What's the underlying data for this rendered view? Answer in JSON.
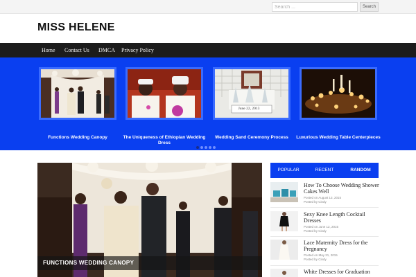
{
  "search": {
    "placeholder": "Search ...",
    "button_label": "Search"
  },
  "site": {
    "title": "MISS HELENE"
  },
  "nav": {
    "items": [
      "Home",
      "Contact Us",
      "DMCA",
      "Privacy Policy"
    ]
  },
  "slider": {
    "slides": [
      {
        "caption": "Functions Wedding Canopy"
      },
      {
        "caption": "The Uniqueness of Ethiopian Wedding Dress"
      },
      {
        "caption": "Wedding Sand Ceremony Process",
        "sign_text": "June 22, 2013"
      },
      {
        "caption": "Luxurious Wedding Table Centerpieces"
      }
    ],
    "dot_count": 5,
    "active_dot": 1
  },
  "featured": {
    "title": "FUNCTIONS WEDDING CANOPY"
  },
  "sidebar": {
    "tabs": [
      "POPULAR",
      "RECENT",
      "RANDOM"
    ],
    "active_tab": "RANDOM",
    "posts": [
      {
        "title": "How To Choose Wedding Shower Cakes Well",
        "date": "Posted on August 13, 2015",
        "author": "Posted by Cindy"
      },
      {
        "title": "Sexy Knee Length Cocktail Dresses",
        "date": "Posted on June 12, 2015",
        "author": "Posted by Cindy"
      },
      {
        "title": "Lace Maternity Dress for the Pregnancy",
        "date": "Posted on May 21, 2015",
        "author": "Posted by Cindy"
      },
      {
        "title": "White Dresses for Graduation",
        "date": "",
        "author": ""
      }
    ]
  },
  "colors": {
    "accent": "#0a3ff0",
    "nav_bg": "#1c1c1c"
  }
}
